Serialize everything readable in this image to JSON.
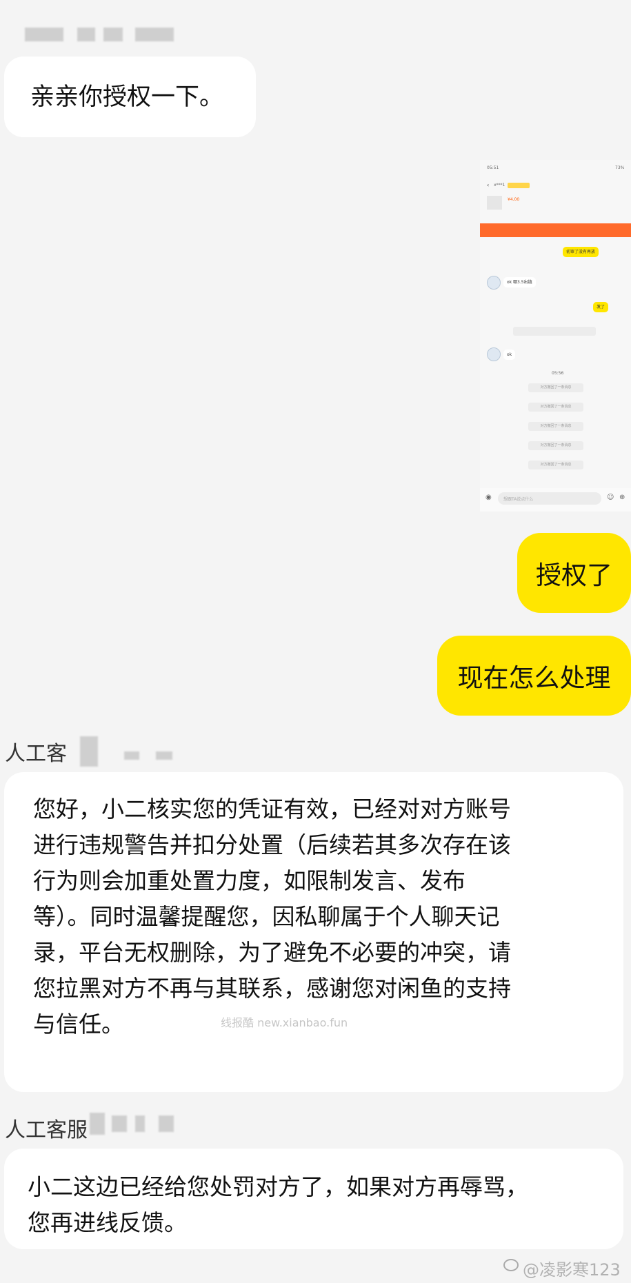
{
  "messages": {
    "m1": "亲亲你授权一下。",
    "m2": "授权了",
    "m3": "现在怎么处理",
    "m4_lines": [
      "您好，小二核实您的凭证有效，已经对对方账号",
      "进行违规警告并扣分处置（后续若其多次存在该",
      "行为则会加重处置力度，如限制发言、发布",
      "等）。同时温馨提醒您，因私聊属于个人聊天记",
      "录，平台无权删除，为了避免不必要的冲突，请",
      "您拉黑对方不再与其联系，感谢您对闲鱼的支持",
      "与信任。"
    ],
    "m5_lines": [
      "小二这边已经给您处罚对方了，如果对方再辱骂，",
      "您再进线反馈。"
    ]
  },
  "senders": {
    "agent1": "人工客",
    "agent2": "人工客服"
  },
  "embedded": {
    "time": "05:51",
    "battery": "73%",
    "user": "x***1",
    "price": "¥4.00",
    "bubble1": "初审了没有再放",
    "bubble2": "ok 哪3.5出链",
    "bubble3": "发了",
    "system": "对方撤回了一条消息",
    "ok": "ok",
    "time2": "05:56",
    "input_placeholder": "想跟TA说点什么"
  },
  "watermarks": {
    "center": "线报酷 new.xianbao.fun",
    "corner": "@凌影寒123"
  },
  "colors": {
    "accent_yellow": "#ffe600",
    "background": "#f4f4f4",
    "bubble_white": "#ffffff"
  }
}
